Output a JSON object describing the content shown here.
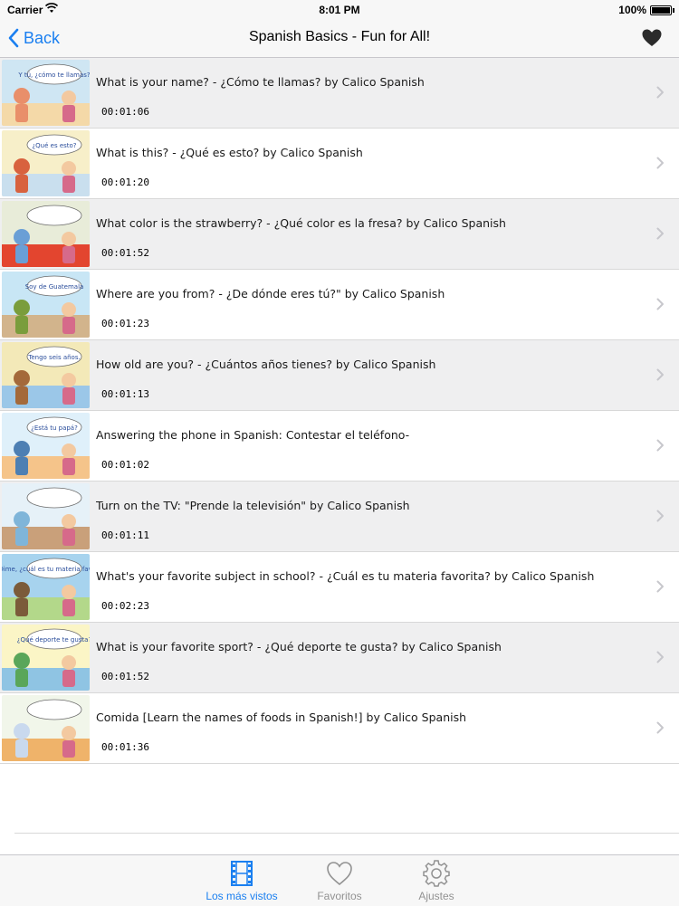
{
  "status": {
    "carrier": "Carrier",
    "time": "8:01 PM",
    "battery": "100%"
  },
  "nav": {
    "back_label": "Back",
    "title": "Spanish Basics - Fun for All!"
  },
  "videos": [
    {
      "title": "What is your name? - ¿Cómo te llamas? by Calico Spanish",
      "duration": "00:01:06",
      "thumb_text": "Y tú, ¿cómo te llamas?"
    },
    {
      "title": "What is this? - ¿Qué es esto? by Calico Spanish",
      "duration": "00:01:20",
      "thumb_text": "¿Qué es esto?"
    },
    {
      "title": "What color is the strawberry? - ¿Qué color es la fresa? by Calico Spanish",
      "duration": "00:01:52",
      "thumb_text": ""
    },
    {
      "title": "Where are you from? - ¿De dónde eres tú?\" by Calico Spanish",
      "duration": "00:01:23",
      "thumb_text": "Soy de Guatemala"
    },
    {
      "title": "How old are you? - ¿Cuántos años tienes? by Calico Spanish",
      "duration": "00:01:13",
      "thumb_text": "Tengo seis años."
    },
    {
      "title": "Answering the phone in Spanish: Contestar el teléfono-",
      "duration": "00:01:02",
      "thumb_text": "¿Está tu papá?"
    },
    {
      "title": "Turn on the TV: \"Prende la televisión\" by Calico Spanish",
      "duration": "00:01:11",
      "thumb_text": ""
    },
    {
      "title": "What's your favorite subject in school? - ¿Cuál es tu materia favorita? by Calico Spanish",
      "duration": "00:02:23",
      "thumb_text": "Dime, ¿cuál es tu materia favorita?"
    },
    {
      "title": "What is your favorite sport? - ¿Qué deporte te gusta? by Calico Spanish",
      "duration": "00:01:52",
      "thumb_text": "¿Qué deporte te gusta?"
    },
    {
      "title": "Comida [Learn the names of foods in Spanish!] by Calico Spanish",
      "duration": "00:01:36",
      "thumb_text": ""
    }
  ],
  "tabs": [
    {
      "label": "Los más vistos",
      "icon": "film-icon",
      "active": true
    },
    {
      "label": "Favoritos",
      "icon": "heart-outline-icon",
      "active": false
    },
    {
      "label": "Ajustes",
      "icon": "gear-icon",
      "active": false
    }
  ],
  "colors": {
    "accent": "#1a7ff0",
    "row_alt": "#efeff0",
    "bar_bg": "#f7f7f7"
  }
}
